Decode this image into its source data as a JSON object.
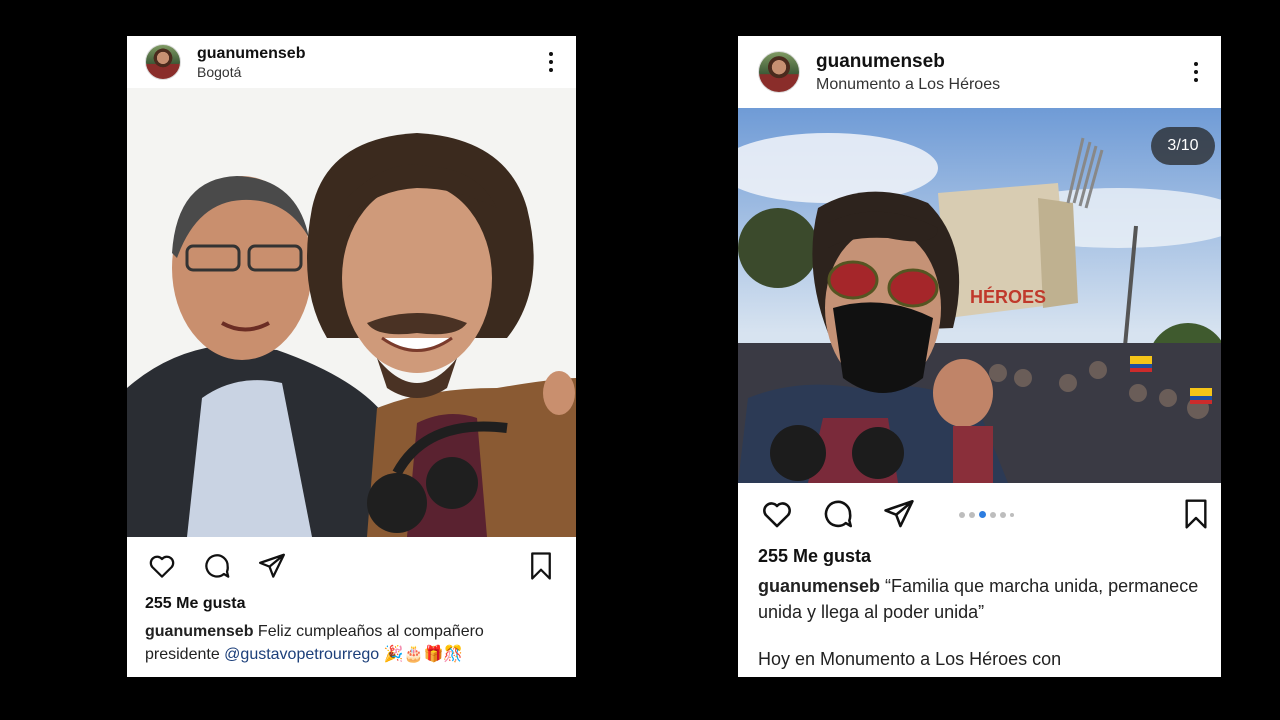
{
  "posts": [
    {
      "username": "guanumenseb",
      "location": "Bogotá",
      "likes": "255 Me gusta",
      "caption_text": "Feliz cumpleaños al compañero",
      "caption_line2": "presidente",
      "mention": "@gustavopetrourrego",
      "emojis": "🎉🎂🎁🎊"
    },
    {
      "username": "guanumenseb",
      "location": "Monumento a Los Héroes",
      "counter": "3/10",
      "likes": "255 Me gusta",
      "caption_text": "“Familia que marcha unida, permanece unida y llega al poder unida”",
      "caption_more": "Hoy en Monumento a Los Héroes con"
    }
  ],
  "icons": [
    "heart-icon",
    "comment-icon",
    "share-icon",
    "bookmark-icon",
    "more-options-icon"
  ],
  "colors": {
    "mention": "#1c3f7a",
    "carousel_active": "#2d7de0",
    "background": "#000000"
  }
}
